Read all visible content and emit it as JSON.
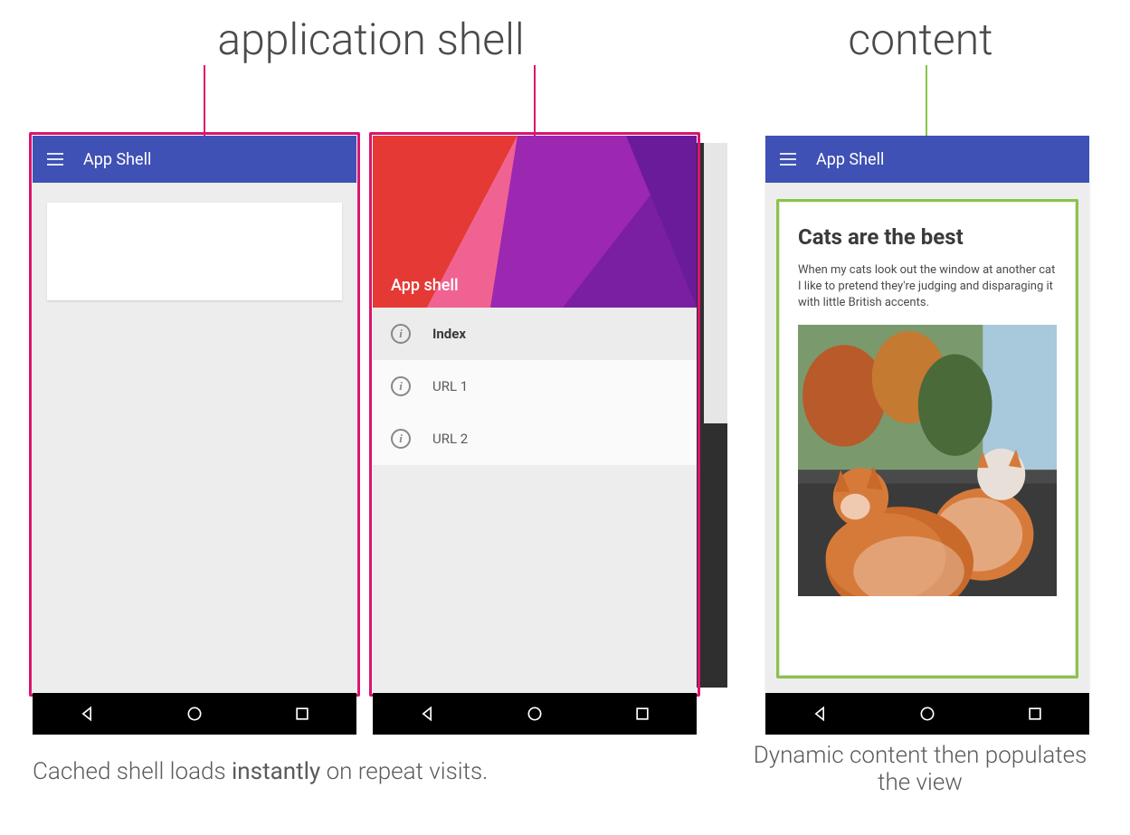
{
  "labels": {
    "shell": "application shell",
    "content": "content"
  },
  "appbar_title": "App Shell",
  "drawer": {
    "header_title": "App shell",
    "items": [
      {
        "label": "Index",
        "active": true
      },
      {
        "label": "URL 1",
        "active": false
      },
      {
        "label": "URL 2",
        "active": false
      }
    ]
  },
  "content_card": {
    "title": "Cats are the best",
    "body": "When my cats look out the window at another cat I like to pretend they're judging and disparaging it with little British accents."
  },
  "captions": {
    "left_prefix": "Cached shell loads ",
    "left_bold": "instantly",
    "left_suffix": " on repeat visits.",
    "right": "Dynamic content then populates the view"
  },
  "colors": {
    "shell_outline": "#d9156f",
    "content_outline": "#8bc34a",
    "appbar": "#3f51b5"
  }
}
